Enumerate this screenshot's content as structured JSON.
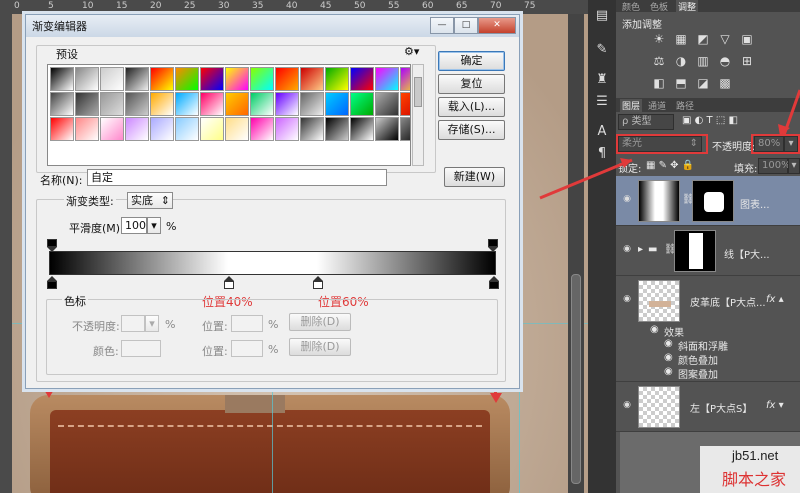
{
  "ruler": {
    "marks": [
      "0",
      "5",
      "10",
      "15",
      "20",
      "25",
      "30",
      "35",
      "40",
      "45",
      "50",
      "55",
      "60",
      "65",
      "70",
      "75"
    ]
  },
  "dialog": {
    "title": "渐变编辑器",
    "presets_label": "预设",
    "buttons": {
      "ok": "确定",
      "reset": "复位",
      "load": "载入(L)...",
      "save": "存储(S)...",
      "new": "新建(W)"
    },
    "name_label": "名称(N):",
    "name_value": "自定",
    "gradient_type_label": "渐变类型:",
    "gradient_type_value": "实底",
    "smoothness_label": "平滑度(M):",
    "smoothness_value": "100",
    "smoothness_unit": "%",
    "color_stops_label": "色标",
    "opacity_label": "不透明度:",
    "opacity_unit": "%",
    "location_label": "位置:",
    "location_unit": "%",
    "delete_label": "删除(D)",
    "color_label": "颜色:",
    "annotation_40": "位置40%",
    "annotation_60": "位置60%"
  },
  "presets_colors": [
    "#000,#fff",
    "#888,#fff",
    "#ccc,#fff",
    "#222,#eee",
    "#f00,#ff0",
    "#f80,#0f0",
    "#f00,#00f",
    "#ff0,#f0f",
    "#8f0,#0ff",
    "#f00,#fa0",
    "#c00,#fc8",
    "#0a0,#ff0",
    "#00f,#f00",
    "#f0f,#0ff",
    "#a0f,#ff0",
    "#444,#fff",
    "#333,#aaa",
    "#999,#ddd",
    "#555,#ccc",
    "#fa0,#fff",
    "#0af,#fff",
    "#f06,#fff",
    "#fc0,#f60",
    "#0c6,#fff",
    "#60f,#fff",
    "#666,#eee",
    "#0cf,#06f",
    "#0f8,#0a0",
    "#aaa,#333",
    "#f40,#c00",
    "#f00,#fff",
    "#f88,#fff",
    "#fff,#f8c",
    "#c8f,#fff",
    "#aaf,#fff",
    "#8cf,#fff",
    "#fff,#ff8",
    "#fd8,#fff",
    "#f0a,#fff",
    "#c6f,#fff",
    "#333,#fff",
    "#000,#ccc",
    "#000,#fff",
    "#ccc,#000",
    "#888,#000"
  ],
  "gradient": {
    "stops_location_percent": [
      0,
      40,
      60,
      100
    ],
    "colors": [
      "#000000",
      "#ffffff",
      "#ffffff",
      "#000000"
    ]
  },
  "panel": {
    "top_tabs": [
      "颜色",
      "色板",
      "调整"
    ],
    "adjust_title": "添加调整",
    "layer_tabs": [
      "图层",
      "通道",
      "路径"
    ],
    "filter_label": "ρ 类型",
    "blend_mode": "柔光",
    "opacity_label": "不透明度:",
    "opacity_value": "80%",
    "lock_label": "锁定:",
    "fill_label": "填充:",
    "fill_value": "100%",
    "layers": [
      {
        "name": "图表..."
      },
      {
        "name": "线【P大..."
      },
      {
        "name": "皮革底【P大点..."
      },
      {
        "name": "左【P大点S】"
      }
    ],
    "effects_label": "效果",
    "effects": [
      "斜面和浮雕",
      "颜色叠加",
      "图案叠加"
    ]
  },
  "watermark": {
    "site": "jb51.net",
    "text": "脚本之家"
  }
}
